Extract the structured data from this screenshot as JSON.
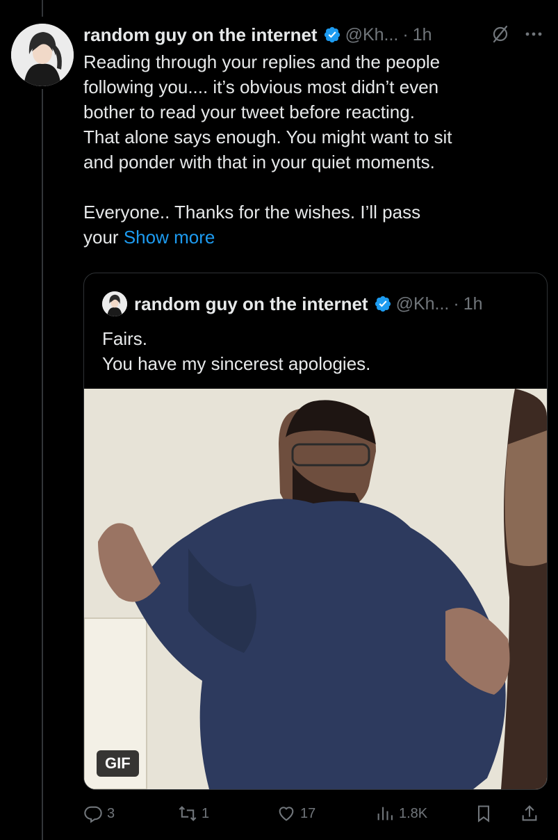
{
  "tweet": {
    "author_name": "random guy on the internet",
    "author_handle": "@Kh...",
    "separator": "·",
    "time": "1h",
    "text": "Reading through your replies and the people\nfollowing you.... it’s obvious most didn’t even\nbother to read your tweet before reacting.\nThat alone says enough. You might want to sit\nand ponder with that in your quiet moments.\n\nEveryone.. Thanks for the wishes. I’ll pass\nyour ",
    "show_more": "Show more",
    "icons": {
      "verified": "verified-badge-icon",
      "grok": "grok-icon",
      "more": "more-icon"
    },
    "verified_color": "#1d9bf0"
  },
  "quote": {
    "author_name": "random guy on the internet",
    "author_handle": "@Kh...",
    "separator": "·",
    "time": "1h",
    "text": "Fairs.\nYou have my sincerest apologies.",
    "media_badge": "GIF"
  },
  "actions": {
    "replies": "3",
    "reposts": "1",
    "likes": "17",
    "views": "1.8K",
    "icons": [
      "reply-icon",
      "repost-icon",
      "like-icon",
      "views-icon",
      "bookmark-icon",
      "share-icon"
    ]
  }
}
